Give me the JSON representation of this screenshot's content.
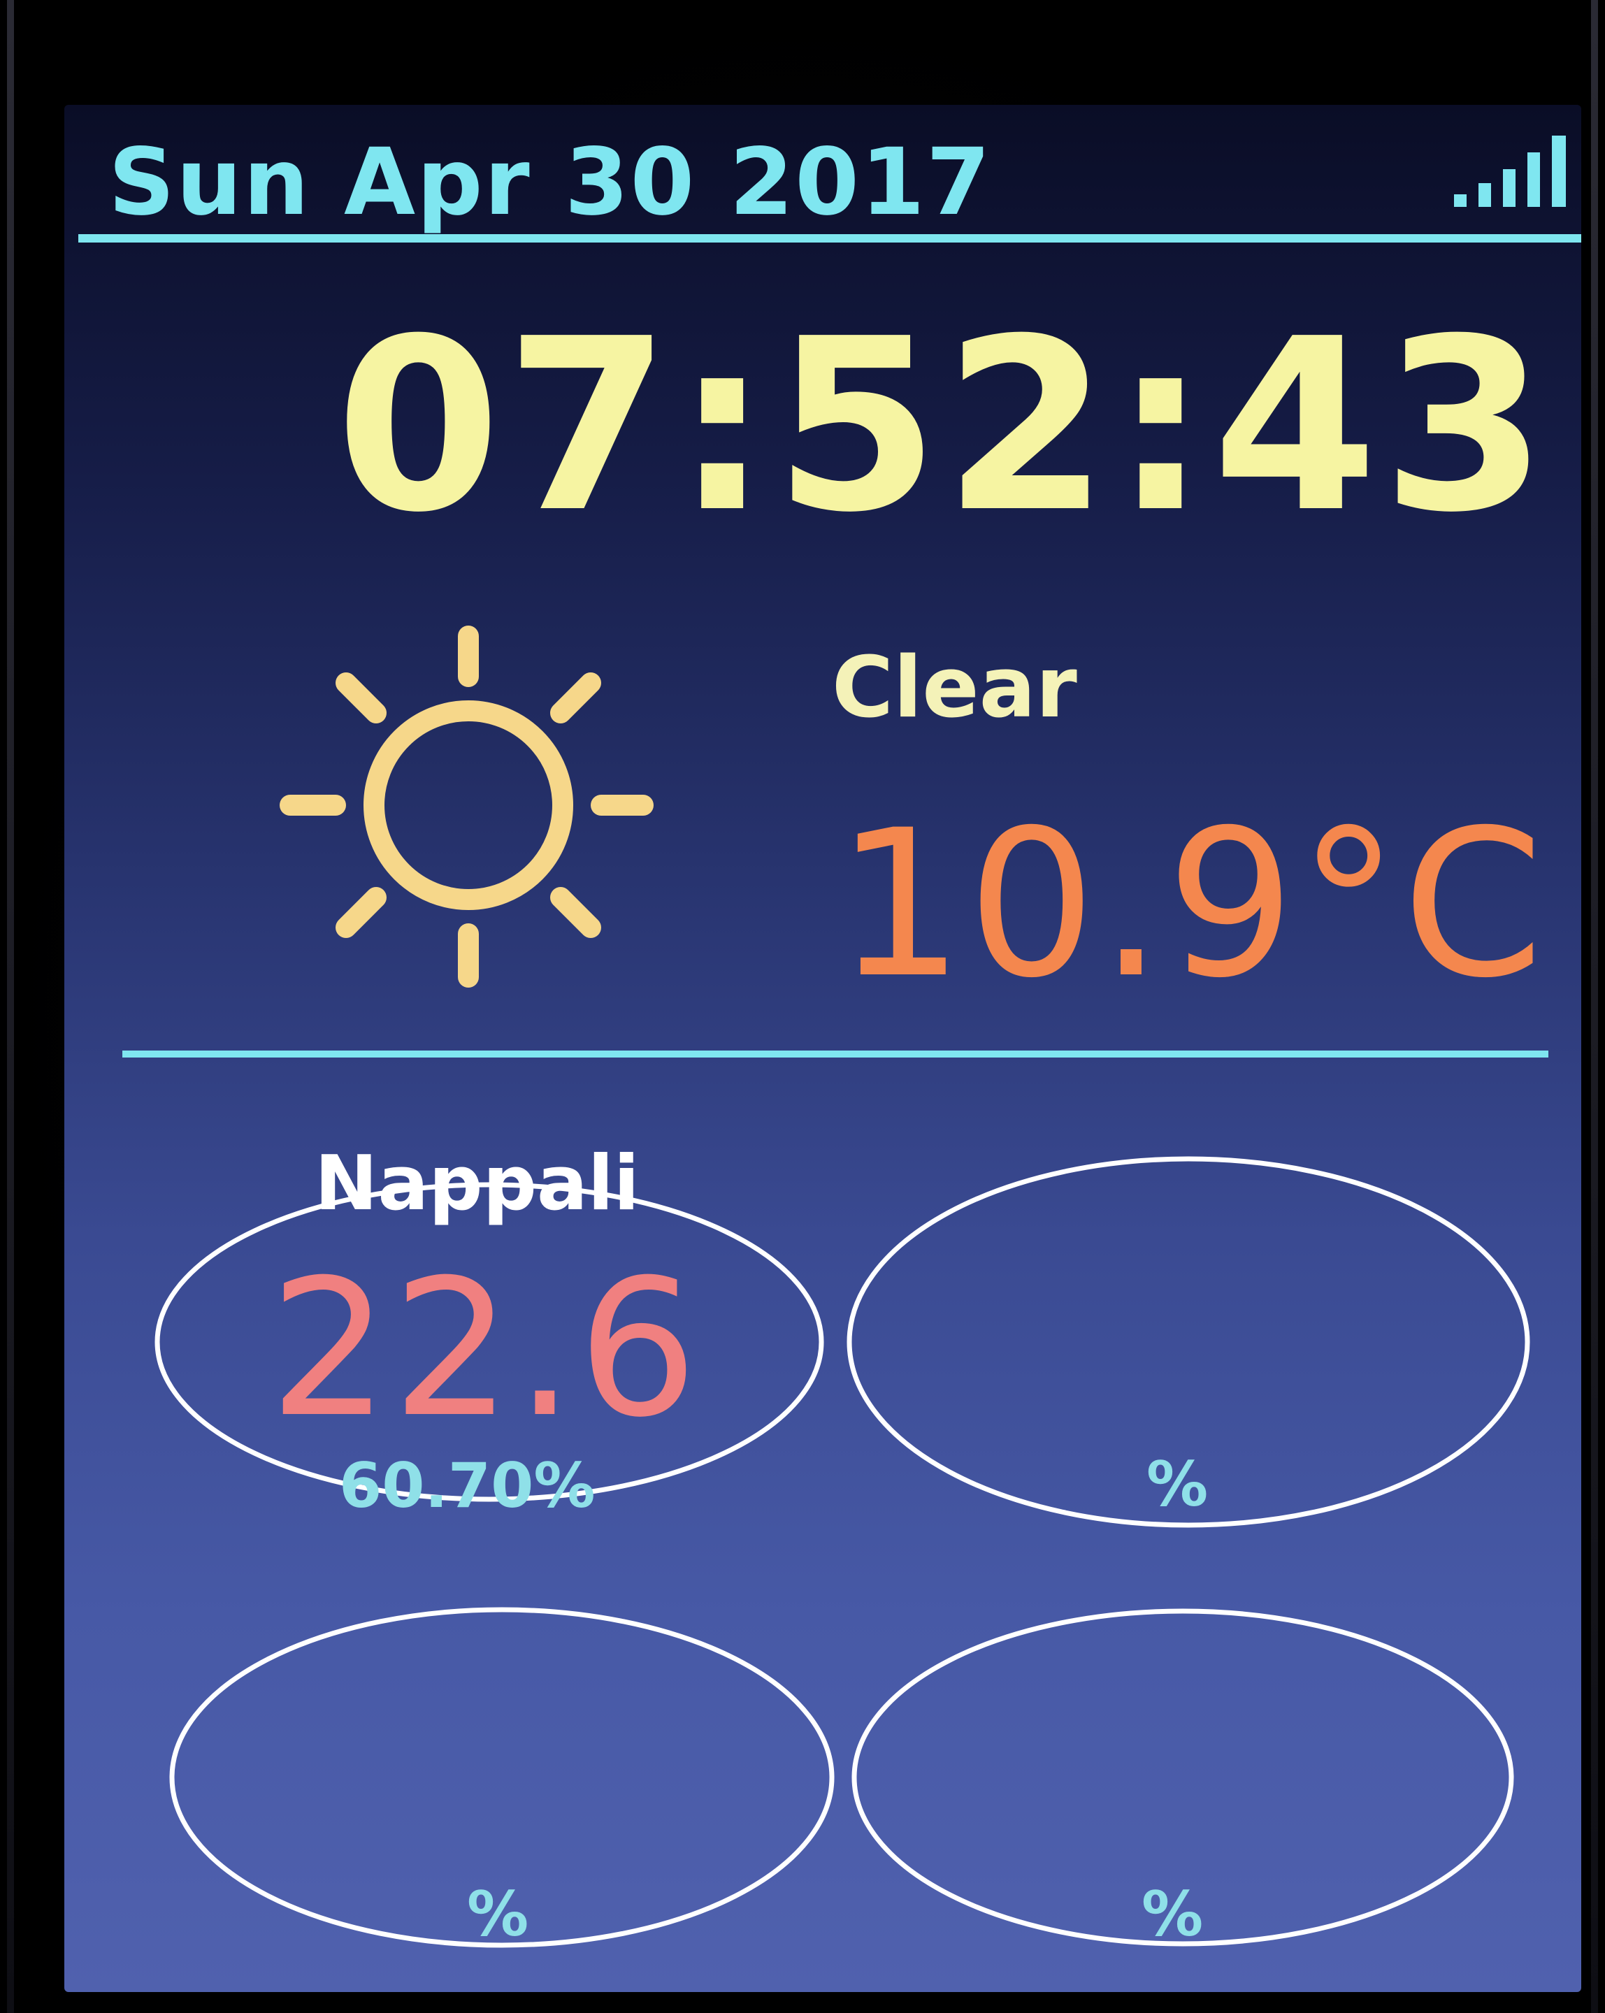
{
  "header": {
    "date": "Sun Apr 30 2017",
    "signal_icon": "signal-bars-icon"
  },
  "clock": {
    "time": "07:52:43"
  },
  "weather": {
    "icon": "sun-icon",
    "condition": "Clear",
    "temperature": "10.9°C"
  },
  "sensors": [
    {
      "label": "Nappali",
      "temperature": "22.6",
      "humidity": "60.70%"
    },
    {
      "label": "",
      "temperature": "",
      "humidity": "%"
    },
    {
      "label": "",
      "temperature": "",
      "humidity": "%"
    },
    {
      "label": "",
      "temperature": "",
      "humidity": "%"
    }
  ],
  "colors": {
    "accent_cyan": "#7fe6f0",
    "clock_yellow": "#f6f4a2",
    "outdoor_orange": "#f4874e",
    "sensor_red": "#f08080",
    "gauge_white": "#ffffff"
  }
}
